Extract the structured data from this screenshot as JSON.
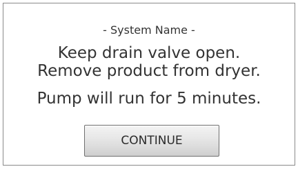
{
  "dialog": {
    "system_name": "- System Name -",
    "messages": [
      "Keep drain valve open.",
      "Remove product from dryer.",
      "Pump will run for 5 minutes."
    ],
    "continue_label": "CONTINUE"
  },
  "colors": {
    "text": "#333333",
    "frame_border": "#8a8a8a",
    "button_border": "#6f6f6f",
    "background": "#ffffff"
  }
}
